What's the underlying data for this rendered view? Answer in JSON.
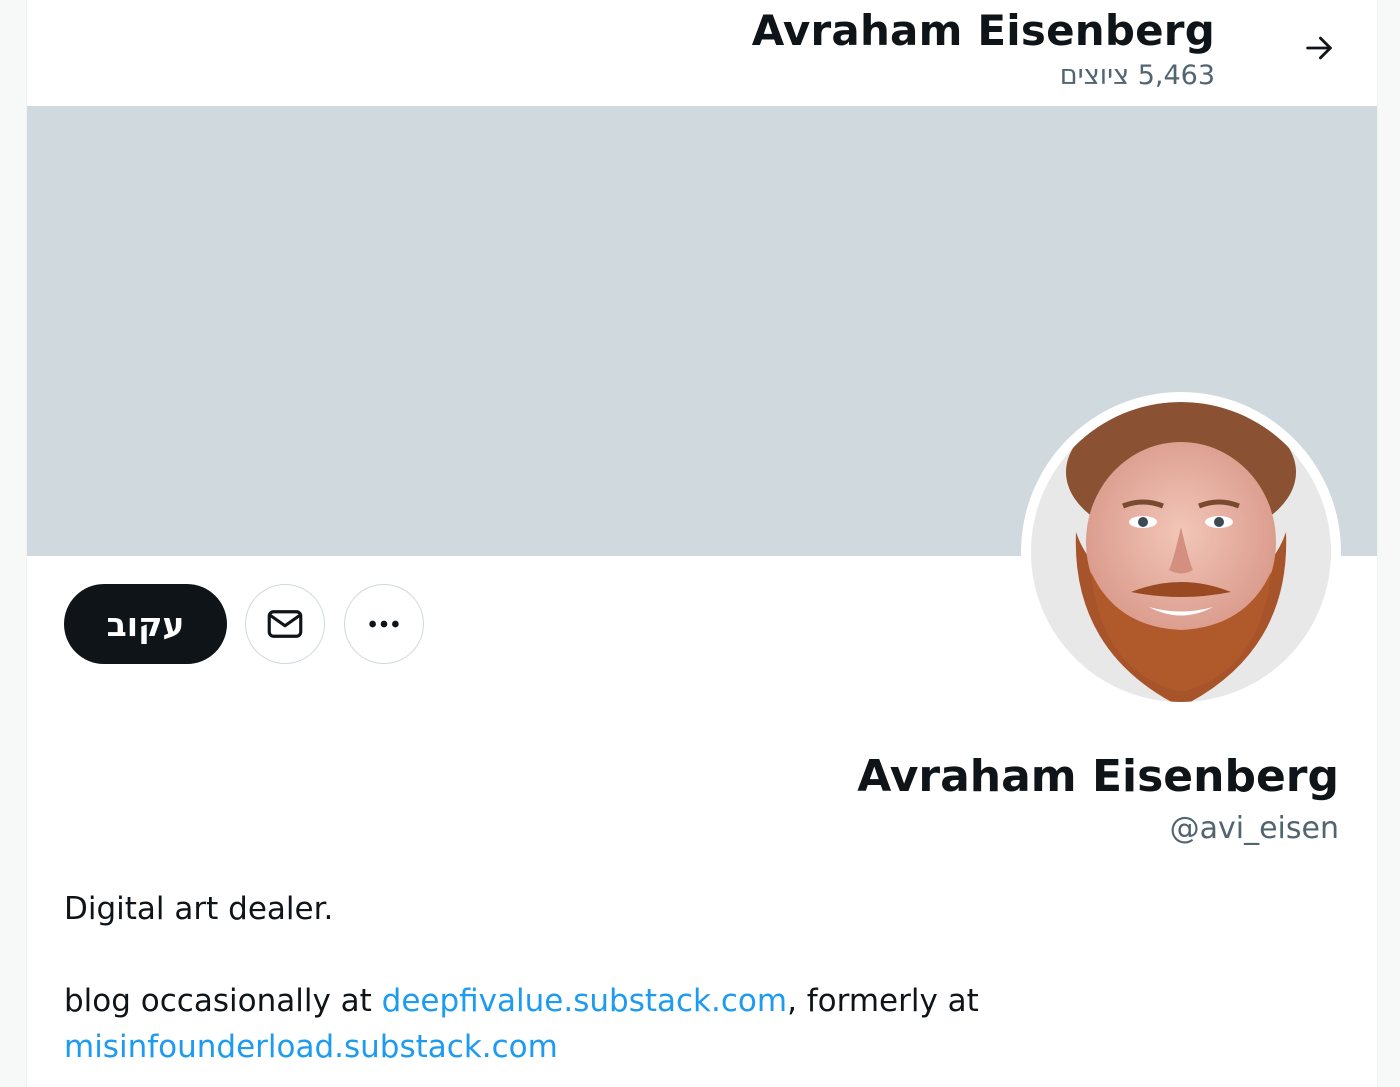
{
  "header": {
    "name": "Avraham Eisenberg",
    "tweet_count": "5,463 ציוצים"
  },
  "icons": {
    "back": "arrow-right-icon",
    "message": "envelope-icon",
    "more": "ellipsis-icon"
  },
  "colors": {
    "banner": "#cfd9de",
    "follow_button": "#0f1419",
    "link": "#1d9bf0",
    "secondary_text": "#536471"
  },
  "actions": {
    "follow_label": "עקוב"
  },
  "profile": {
    "name": "Avraham Eisenberg",
    "handle": "@avi_eisen"
  },
  "bio": {
    "line1": "Digital art dealer.",
    "line2_prefix": "blog occasionally at ",
    "link1": "deepfivalue.substack.com",
    "line2_middle": ", formerly at",
    "link2": "misinfounderload.substack.com"
  }
}
